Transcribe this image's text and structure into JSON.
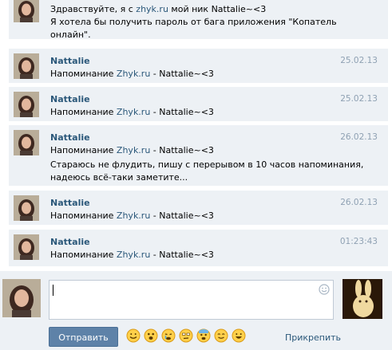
{
  "messages": [
    {
      "author": "",
      "date": "",
      "reminder_prefix": "Здравствуйте, я с ",
      "reminder_link": "zhyk.ru",
      "reminder_suffix": " мой ник Nattalie~<3",
      "extra": [
        "Я хотела бы получить пароль от бага приложения \"Копатель",
        "онлайн\"."
      ]
    },
    {
      "author": "Nattalie",
      "date": "25.02.13",
      "reminder_prefix": "Напоминание ",
      "reminder_link": "Zhyk.ru",
      "reminder_suffix": " - Nattalie~<3",
      "extra": []
    },
    {
      "author": "Nattalie",
      "date": "25.02.13",
      "reminder_prefix": "Напоминание ",
      "reminder_link": "Zhyk.ru",
      "reminder_suffix": " - Nattalie~<3",
      "extra": []
    },
    {
      "author": "Nattalie",
      "date": "26.02.13",
      "reminder_prefix": "Напоминание ",
      "reminder_link": "Zhyk.ru",
      "reminder_suffix": " - Nattalie~<3",
      "extra": [
        "Стараюсь не флудить, пишу с перерывом в 10 часов напоминания,",
        "надеюсь всё-таки заметите..."
      ]
    },
    {
      "author": "Nattalie",
      "date": "26.02.13",
      "reminder_prefix": "Напоминание ",
      "reminder_link": "Zhyk.ru",
      "reminder_suffix": " - Nattalie~<3",
      "extra": []
    },
    {
      "author": "Nattalie",
      "date": "01:23:43",
      "reminder_prefix": "Напоминание ",
      "reminder_link": "Zhyk.ru",
      "reminder_suffix": " - Nattalie~<3",
      "extra": []
    }
  ],
  "composer": {
    "input_value": "",
    "send_label": "Отправить",
    "attach_label": "Прикрепить",
    "emoji_icon": "smiley-icon",
    "emoticons": [
      "smile",
      "shocked",
      "crying",
      "suspicious",
      "scared",
      "content",
      "laughing"
    ]
  },
  "colors": {
    "link": "#2b587a",
    "date": "#8fa1b3",
    "message_bg": "#edf1f5",
    "send_button": "#5e82a8"
  }
}
